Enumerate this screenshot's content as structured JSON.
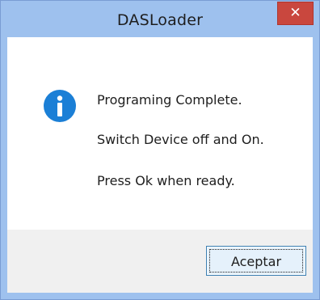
{
  "window": {
    "title": "DASLoader",
    "close_glyph": "✕"
  },
  "message": {
    "icon": "info-icon",
    "line1": "Programing Complete.",
    "line2": "Switch Device off and On.",
    "line3": "Press Ok when ready."
  },
  "buttons": {
    "ok_label": "Aceptar"
  },
  "colors": {
    "frame": "#9ec1ee",
    "close_button": "#c9473e",
    "info_icon": "#1b7fd6"
  }
}
